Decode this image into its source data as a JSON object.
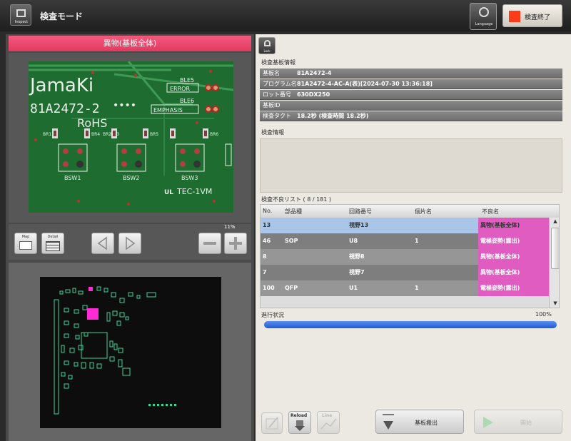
{
  "header": {
    "inspect_icon_label": "Inspect",
    "mode_title": "検査モード",
    "language_label": "Language",
    "end_button_label": "検査終了",
    "stop_color": "#ff3b1a"
  },
  "left_panel": {
    "view_title": "異物(基板全体)",
    "pcb": {
      "brand": "JamaKi",
      "model": "81A2472-2",
      "dots": "••••",
      "rohs": "RoHS",
      "ble5": "BLE5",
      "error": "ERROR",
      "ble6": "BLE6",
      "emphasis": "EMPHASIS",
      "br_labels": [
        "BR1",
        "BR2",
        "BR3",
        "BR4",
        "BR5",
        "BR6"
      ],
      "bsw_labels": [
        "BSW1",
        "BSW2",
        "BSW3"
      ],
      "tec": "TEC-1VM",
      "ul_mark": "UL"
    },
    "map_button_label": "Map",
    "detail_button_label": "Detail",
    "zoom_percent": "11%"
  },
  "right_panel": {
    "lock_label": "Lock",
    "board_info_heading": "検査基板情報",
    "board_info": [
      {
        "key": "基板名",
        "value": "81A2472-4"
      },
      {
        "key": "プログラム名",
        "value": "81A2472-4-AC-A(表)[2024-07-30 13:36:18]"
      },
      {
        "key": "ロット番号",
        "value": "630DX250"
      },
      {
        "key": "基板ID",
        "value": ""
      },
      {
        "key": "検査タクト",
        "value": "18.2秒 (検査時間 18.2秒)"
      }
    ],
    "inspection_info_heading": "検査情報",
    "defect_list_heading": "検査不良リスト ( 8 / 181 )",
    "table": {
      "headers": [
        "No.",
        "部品種",
        "回路番号",
        "個片名",
        "不良名"
      ],
      "rows": [
        {
          "no": "13",
          "part": "",
          "circuit": "視野13",
          "piece": "",
          "defect": "異物(基板全体)",
          "selected": true
        },
        {
          "no": "46",
          "part": "SOP",
          "circuit": "U8",
          "piece": "1",
          "defect": "電極姿勢(露出)",
          "selected": false
        },
        {
          "no": "8",
          "part": "",
          "circuit": "視野8",
          "piece": "",
          "defect": "異物(基板全体)",
          "selected": false
        },
        {
          "no": "7",
          "part": "",
          "circuit": "視野7",
          "piece": "",
          "defect": "異物(基板全体)",
          "selected": false
        },
        {
          "no": "100",
          "part": "QFP",
          "circuit": "U1",
          "piece": "1",
          "defect": "電極姿勢(露出)",
          "selected": false
        }
      ]
    },
    "progress_label": "進行状況",
    "progress_percent_text": "100%",
    "progress_value": 1.0,
    "reload_label": "Reload",
    "line_label": "Line",
    "unload_button_label": "基板搬出",
    "start_button_label": "開始"
  }
}
